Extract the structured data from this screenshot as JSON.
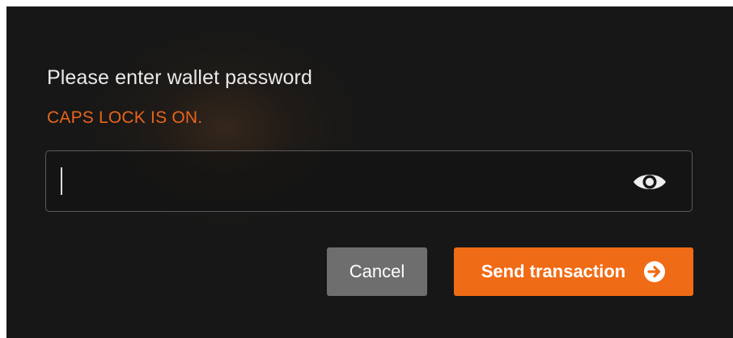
{
  "dialog": {
    "title": "Please enter wallet password",
    "warning": "CAPS LOCK IS ON.",
    "password": {
      "value": "",
      "placeholder": "",
      "toggle_icon": "eye-icon"
    },
    "buttons": {
      "cancel_label": "Cancel",
      "send_label": "Send transaction",
      "send_icon": "arrow-right-circle-icon"
    }
  },
  "colors": {
    "background": "#171717",
    "warning": "#e8651c",
    "primary": "#f06b16",
    "secondary": "#6e6e6e",
    "text": "#e9e9e9"
  }
}
